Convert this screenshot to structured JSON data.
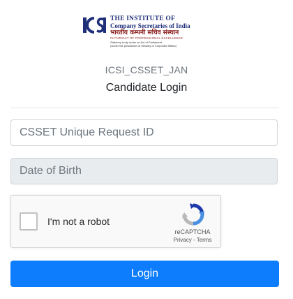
{
  "logo": {
    "monogram": "ICSI",
    "line1": "THE INSTITUTE OF",
    "line2": "Company Secretaries of India",
    "line3": "भारतीय कम्पनी सचिव संस्थान",
    "line4": "IN PURSUIT OF PROFESSIONAL EXCELLENCE",
    "line5": "Statutory body under an Act of Parliament",
    "line6": "(Under the jurisdiction of Ministry of Corporate Affairs)"
  },
  "exam_code": "ICSI_CSSET_JAN",
  "page_title": "Candidate Login",
  "form": {
    "request_id_placeholder": "CSSET Unique Request ID",
    "dob_placeholder": "Date of Birth"
  },
  "captcha": {
    "label": "I'm not a robot",
    "brand": "reCAPTCHA",
    "privacy": "Privacy",
    "separator": " - ",
    "terms": "Terms"
  },
  "login_button": "Login",
  "colors": {
    "primary": "#0d7dfd",
    "logo_blue": "#1f2f7a",
    "logo_maroon": "#8a1a1a"
  }
}
